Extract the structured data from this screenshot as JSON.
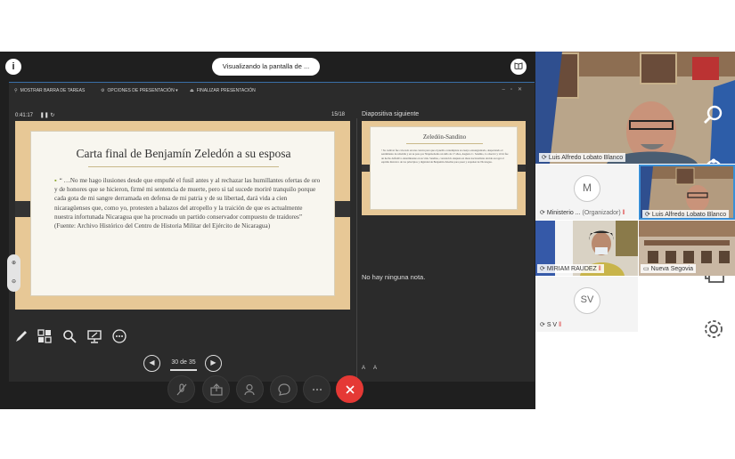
{
  "share_bar": {
    "info_icon": "i",
    "status_text": "Visualizando la pantalla de ...",
    "book_icon": "book-icon"
  },
  "presenter": {
    "toolbar": {
      "show_taskbar": "MOSTRAR BARRA DE TAREAS",
      "presentation_options": "OPCIONES DE PRESENTACIÓN ▾",
      "end_presentation": "FINALIZAR PRESENTACIÓN"
    },
    "timer": "0:41:17",
    "timer_controls": "❚❚  ↻",
    "slide_counter": "15/18",
    "next_slide_label": "Diapositiva siguiente",
    "notes_text": "No hay ninguna nota.",
    "zoom": {
      "in": "⊕",
      "out": "⊖"
    },
    "nav": {
      "position": "30 de 35",
      "prev": "◀",
      "next": "▶"
    }
  },
  "current_slide": {
    "title": "Carta final de Benjamín Zeledón a su esposa",
    "body": "“ …No me hago ilusiones desde que empuñé el fusil antes y al rechazar las humillantes ofertas de oro y de honores que se hicieron, firmé mi sentencia de muerte, pero si tal sucede moriré tranquilo porque cada gota de mi sangre derramada en defensa de mi patria y de su libertad, dará vida a cien nicaragüenses que, como yo, protesten a balazos del atropello y la traición de que es actualmente nuestra infortunada Nicaragua que ha procreado un partido conservador compuesto de traidores” (Fuente: Archivo Histórico del Centro de Historia Militar del Ejército de Nicaragua)"
  },
  "next_slide": {
    "title": "Zeledón-Sandino",
    "body": "• Su cadáver fue colocado en una carreta para que el pueblo contemplara su cuerpo ensangrentado, despertando el sentimiento de rebeldía y en su paso por Niquinohomo un niño de 17 años, Augusto C. Sandino, lo observó y vivió fue un hecho definitivo determinante en su vida. Sandino, convencido después en ideas nacionalistas decide escoger el espíritu histórico de los principios y dignidad de Benjamín Zeledón para pasar y expulsar de Nicaragua."
  },
  "participants": {
    "main": {
      "name": "Luis Alfredo Lobato Blanco"
    },
    "tiles": [
      {
        "initial": "M",
        "name": "Ministerio ...",
        "role": "(Organizador)"
      },
      {
        "name": "Luis Alfredo Lobato Blanco"
      },
      {
        "name": "MIRIAM RAUDEZ"
      },
      {
        "name": "Nueva Segovia"
      },
      {
        "initial": "SV",
        "name": "S V"
      }
    ]
  },
  "colors": {
    "share_bg": "#1f1f1f",
    "active_border": "#3a8fd6",
    "hangup": "#e53935",
    "slide_frame": "#e7c896"
  }
}
